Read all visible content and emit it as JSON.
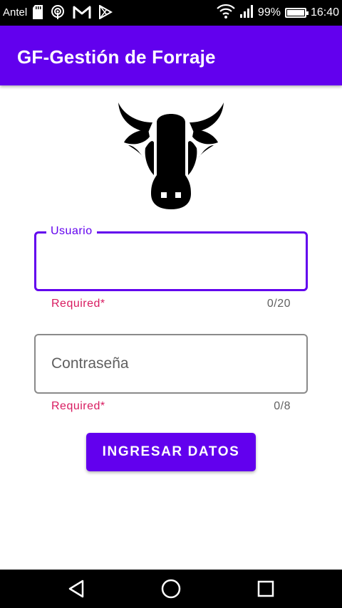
{
  "status_bar": {
    "carrier": "Antel",
    "battery_text": "99%",
    "time": "16:40",
    "icons": [
      "sd-card-icon",
      "hotspot-icon",
      "gmail-icon",
      "play-store-icon",
      "wifi-icon",
      "signal-icon",
      "battery-icon"
    ]
  },
  "app_bar": {
    "title": "GF-Gestión de Forraje"
  },
  "logo": {
    "icon": "cow-head-icon"
  },
  "form": {
    "usuario": {
      "label": "Usuario",
      "value": "",
      "helper": "Required*",
      "counter": "0/20"
    },
    "contrasena": {
      "placeholder": "Contraseña",
      "value": "",
      "helper": "Required*",
      "counter": "0/8"
    },
    "submit_label": "INGRESAR DATOS"
  },
  "nav_bar": {
    "icons": [
      "back-icon",
      "home-icon",
      "recents-icon"
    ]
  },
  "colors": {
    "primary": "#6200ee",
    "error": "#d81b60",
    "status_bar": "#000000"
  }
}
